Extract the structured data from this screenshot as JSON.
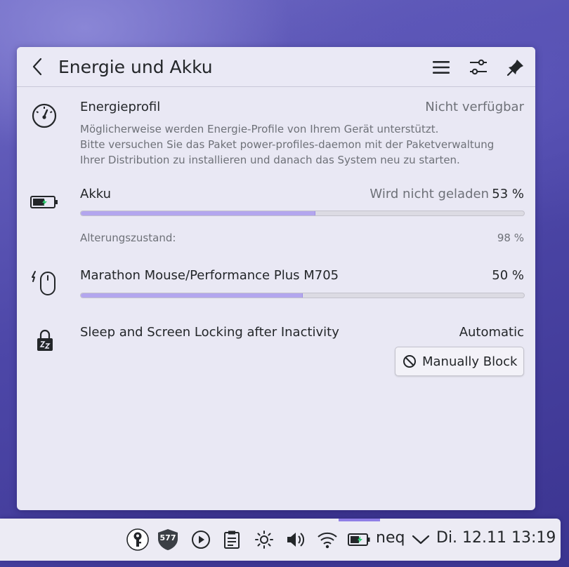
{
  "popup": {
    "title": "Energie und Akku",
    "header_buttons": [
      "hamburger-menu-icon",
      "configure-sliders-icon",
      "pin-icon"
    ]
  },
  "energy_profile": {
    "label": "Energieprofil",
    "status": "Nicht verfügbar",
    "description": [
      "Möglicherweise werden Energie-Profile von Ihrem Gerät unterstützt.",
      "Bitte versuchen Sie das Paket power-profiles-daemon mit der Paketverwaltung",
      "Ihrer Distribution zu installieren und danach das System neu zu starten."
    ],
    "icon": "speedometer-icon"
  },
  "battery": {
    "label": "Akku",
    "status": "Wird nicht geladen",
    "percent_text": "53 %",
    "percent": 53,
    "health_label": "Alterungszustand:",
    "health_value": "98 %",
    "icon": "battery-icon"
  },
  "mouse": {
    "label": "Marathon Mouse/Performance Plus M705",
    "percent_text": "50 %",
    "percent": 50,
    "icon": "wireless-mouse-icon"
  },
  "sleep": {
    "label": "Sleep and Screen Locking after Inactivity",
    "status": "Automatic",
    "button_label": "Manually Block",
    "icon": "lock-sleep-icon"
  },
  "taskbar": {
    "badge_count": "577",
    "user": "neq",
    "datetime": "Di. 12.11 13:19",
    "tray_icons": [
      "keepassxc-icon",
      "shield-updates-icon",
      "media-play-icon",
      "clipboard-icon",
      "brightness-icon",
      "volume-icon",
      "wifi-icon",
      "battery-icon"
    ]
  },
  "colors": {
    "accent": "#b3a6ee",
    "popup_bg": "#e9e8f4",
    "text": "#232629",
    "muted_text": "#6e7178"
  }
}
